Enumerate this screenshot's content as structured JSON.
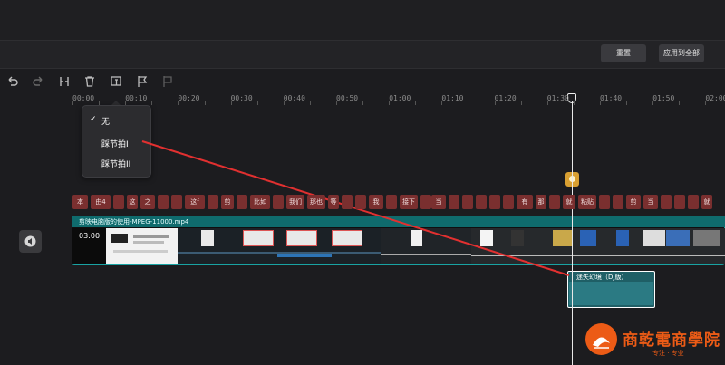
{
  "buttons": {
    "reset": "重置",
    "apply_all": "应用到全部"
  },
  "toolbar": {
    "tools": [
      "undo-icon",
      "redo-icon",
      "split-icon",
      "delete-icon",
      "auto-beat-icon",
      "flag-icon",
      "flag-disabled-icon"
    ]
  },
  "ruler": {
    "labels": [
      "00:00",
      "00:10",
      "00:20",
      "00:30",
      "00:40",
      "00:50",
      "01:00",
      "01:10",
      "01:20",
      "01:30",
      "01:40",
      "01:50",
      "02:00"
    ]
  },
  "menu": {
    "items": [
      "无",
      "踩节拍I",
      "踩节拍II"
    ],
    "selected_index": 0
  },
  "captions": {
    "chips": [
      "本",
      "由4",
      "",
      "这",
      "之",
      "",
      "",
      "这f",
      "",
      "剪",
      "",
      "比如",
      "",
      "我们",
      "那也",
      "等",
      "",
      "",
      "我",
      "",
      "接下",
      "",
      "当",
      "",
      "",
      "",
      "",
      "",
      "有",
      "那",
      "",
      "就",
      "粘贴",
      "",
      "",
      "剪",
      "当",
      "",
      "",
      "",
      "就"
    ]
  },
  "video_track": {
    "title": "剪映电脑版的使用-MPEG-11000.mp4",
    "duration": "03:00"
  },
  "clip_popup": {
    "title": "迷失幻境（DJ版）"
  },
  "logo": {
    "name": "商乾電商學院",
    "tagline": "专注 · 专业"
  },
  "colors": {
    "accent_teal": "#19a3a3",
    "caption_red": "#7a2f2f",
    "logo_orange": "#ec5b16",
    "annotation_red": "#e23030"
  }
}
